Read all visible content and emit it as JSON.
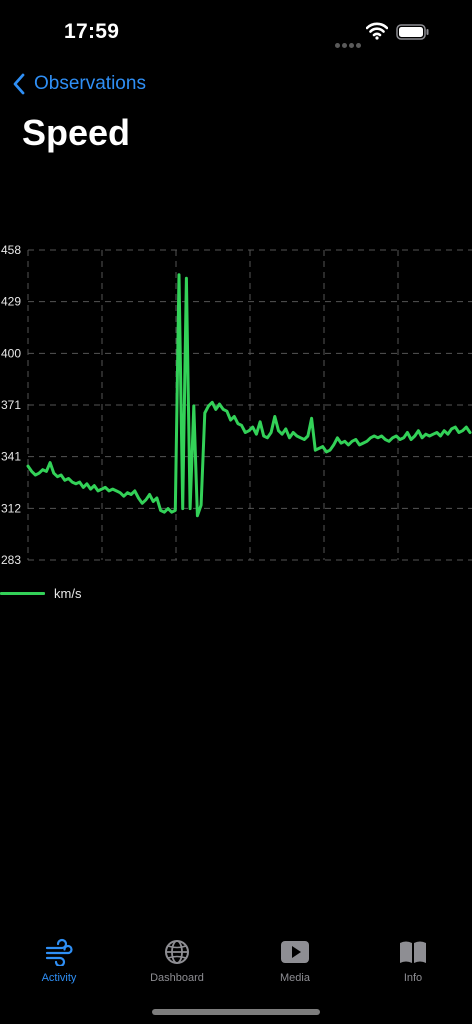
{
  "status": {
    "time": "17:59"
  },
  "nav": {
    "back_label": "Observations"
  },
  "page": {
    "title": "Speed"
  },
  "colors": {
    "accent": "#2f8ff5",
    "line": "#33d158",
    "inactive": "#8e8e93"
  },
  "chart_data": {
    "type": "line",
    "title": "",
    "xlabel": "",
    "ylabel": "",
    "ylim": [
      283,
      458
    ],
    "yticks": [
      "458",
      "429",
      "400",
      "371",
      "341",
      "312",
      "283"
    ],
    "grid": true,
    "legend_placement": "bottom-left",
    "series": [
      {
        "name": "km/s",
        "x": [
          0,
          1,
          2,
          3,
          4,
          5,
          6,
          7,
          8,
          9,
          10,
          11,
          12,
          13,
          14,
          15,
          16,
          17,
          18,
          19,
          20,
          21,
          22,
          23,
          24,
          25,
          26,
          27,
          28,
          29,
          30,
          31,
          32,
          33,
          34,
          35,
          36,
          37,
          38,
          39,
          40,
          41,
          42,
          43,
          44,
          45,
          46,
          47,
          48,
          49,
          50,
          51,
          52,
          53,
          54,
          55,
          56,
          57,
          58,
          59,
          60,
          61,
          62,
          63,
          64,
          65,
          66,
          67,
          68,
          69,
          70,
          71,
          72,
          73,
          74,
          75,
          76,
          77,
          78,
          79,
          80,
          81,
          82,
          83,
          84,
          85,
          86,
          87,
          88,
          89,
          90,
          91,
          92,
          93,
          94,
          95,
          96,
          97,
          98,
          99,
          100,
          101,
          102,
          103,
          104,
          105,
          106,
          107,
          108,
          109,
          110,
          111,
          112,
          113,
          114,
          115,
          116,
          117,
          118,
          119,
          120
        ],
        "y": [
          336,
          333,
          331,
          332,
          334,
          333,
          338,
          332,
          330,
          331,
          328,
          329,
          327,
          326,
          327,
          324,
          326,
          323,
          325,
          322,
          323,
          324,
          322,
          323,
          322,
          321,
          319,
          321,
          320,
          322,
          318,
          315,
          317,
          320,
          316,
          318,
          311,
          310,
          312,
          310,
          311,
          444,
          312,
          442,
          312,
          370,
          308,
          314,
          366,
          370,
          372,
          368,
          371,
          368,
          367,
          362,
          364,
          360,
          359,
          355,
          356,
          358,
          354,
          361,
          353,
          352,
          355,
          364,
          356,
          354,
          357,
          352,
          355,
          353,
          352,
          351,
          353,
          363,
          345,
          346,
          347,
          344,
          345,
          348,
          352,
          349,
          350,
          348,
          350,
          351,
          348,
          349,
          350,
          352,
          353,
          352,
          353,
          351,
          350,
          352,
          353,
          351,
          352,
          355,
          351,
          353,
          356,
          352,
          354,
          353,
          354,
          355,
          353,
          356,
          354,
          357,
          358,
          355,
          356,
          358,
          355
        ]
      }
    ]
  },
  "tabs": [
    {
      "label": "Activity",
      "icon": "wind-icon",
      "active": true
    },
    {
      "label": "Dashboard",
      "icon": "globe-icon",
      "active": false
    },
    {
      "label": "Media",
      "icon": "play-icon",
      "active": false
    },
    {
      "label": "Info",
      "icon": "book-icon",
      "active": false
    }
  ]
}
